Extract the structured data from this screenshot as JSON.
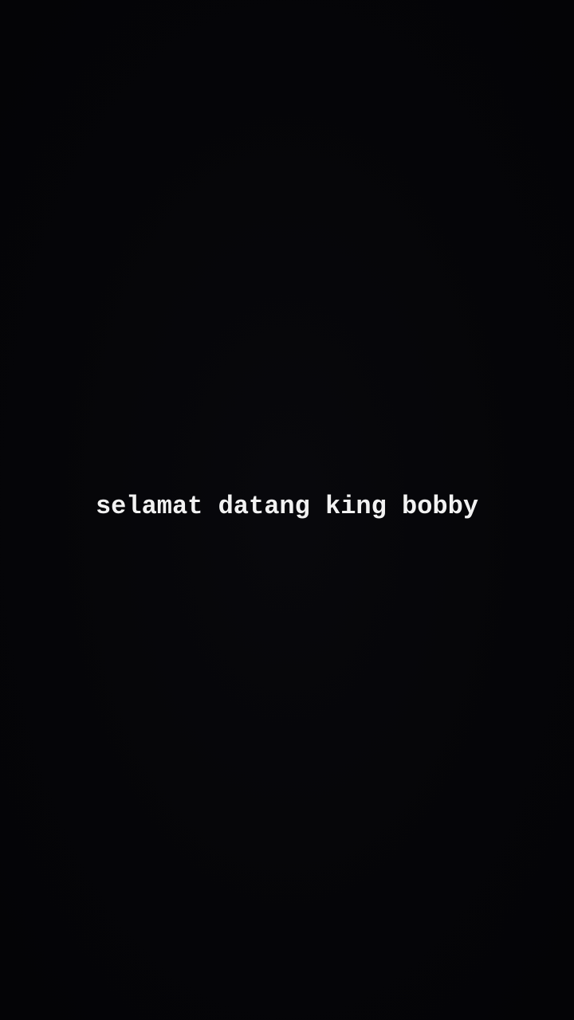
{
  "story": {
    "text": "selamat datang king bobby"
  },
  "colors": {
    "background": "#050508",
    "text": "#f2f2f2"
  }
}
